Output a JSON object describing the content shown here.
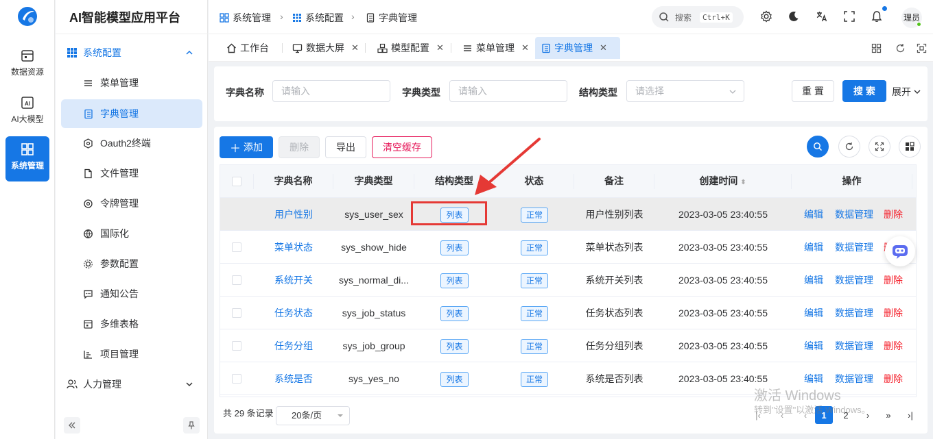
{
  "app": {
    "brand": "AI智能模型应用平台"
  },
  "rail": {
    "items": [
      {
        "label": "数据资源"
      },
      {
        "label": "AI大模型"
      },
      {
        "label": "系统管理"
      }
    ]
  },
  "sidebar": {
    "group_system": "系统配置",
    "items": [
      {
        "label": "菜单管理"
      },
      {
        "label": "字典管理"
      },
      {
        "label": "Oauth2终端"
      },
      {
        "label": "文件管理"
      },
      {
        "label": "令牌管理"
      },
      {
        "label": "国际化"
      },
      {
        "label": "参数配置"
      },
      {
        "label": "通知公告"
      },
      {
        "label": "多维表格"
      },
      {
        "label": "项目管理"
      }
    ],
    "group_hr": "人力管理"
  },
  "breadcrumb": [
    "系统管理",
    "系统配置",
    "字典管理"
  ],
  "topbar": {
    "search_placeholder": "搜索",
    "shortcut": "Ctrl+K",
    "user": "理员"
  },
  "tabs": [
    {
      "label": "工作台"
    },
    {
      "label": "数据大屏"
    },
    {
      "label": "模型配置"
    },
    {
      "label": "菜单管理"
    },
    {
      "label": "字典管理"
    }
  ],
  "filter": {
    "name_label": "字典名称",
    "name_placeholder": "请输入",
    "type_label": "字典类型",
    "type_placeholder": "请输入",
    "struct_label": "结构类型",
    "struct_placeholder": "请选择",
    "reset": "重 置",
    "search": "搜 索",
    "expand": "展开"
  },
  "toolbar": {
    "add": "添加",
    "delete": "删除",
    "export": "导出",
    "clear_cache": "清空缓存"
  },
  "table": {
    "columns": [
      "字典名称",
      "字典类型",
      "结构类型",
      "状态",
      "备注",
      "创建时间",
      "操作"
    ],
    "rows": [
      {
        "name": "用户性别",
        "type": "sys_user_sex",
        "struct": "列表",
        "status": "正常",
        "remark": "用户性别列表",
        "created": "2023-03-05 23:40:55"
      },
      {
        "name": "菜单状态",
        "type": "sys_show_hide",
        "struct": "列表",
        "status": "正常",
        "remark": "菜单状态列表",
        "created": "2023-03-05 23:40:55"
      },
      {
        "name": "系统开关",
        "type": "sys_normal_di...",
        "struct": "列表",
        "status": "正常",
        "remark": "系统开关列表",
        "created": "2023-03-05 23:40:55"
      },
      {
        "name": "任务状态",
        "type": "sys_job_status",
        "struct": "列表",
        "status": "正常",
        "remark": "任务状态列表",
        "created": "2023-03-05 23:40:55"
      },
      {
        "name": "任务分组",
        "type": "sys_job_group",
        "struct": "列表",
        "status": "正常",
        "remark": "任务分组列表",
        "created": "2023-03-05 23:40:55"
      },
      {
        "name": "系统是否",
        "type": "sys_yes_no",
        "struct": "列表",
        "status": "正常",
        "remark": "系统是否列表",
        "created": "2023-03-05 23:40:55"
      }
    ],
    "actions": {
      "edit": "编辑",
      "data": "数据管理",
      "delete": "删除"
    }
  },
  "pagination": {
    "total": "共 29 条记录",
    "page_size": "20条/页",
    "pages": [
      "1",
      "2"
    ],
    "current": "1"
  },
  "watermark": {
    "line1": "激活 Windows",
    "line2": "转到\"设置\"以激活 Windows。"
  },
  "colors": {
    "primary": "#1677e5",
    "danger": "#f5222d",
    "annotation": "#e53935"
  }
}
